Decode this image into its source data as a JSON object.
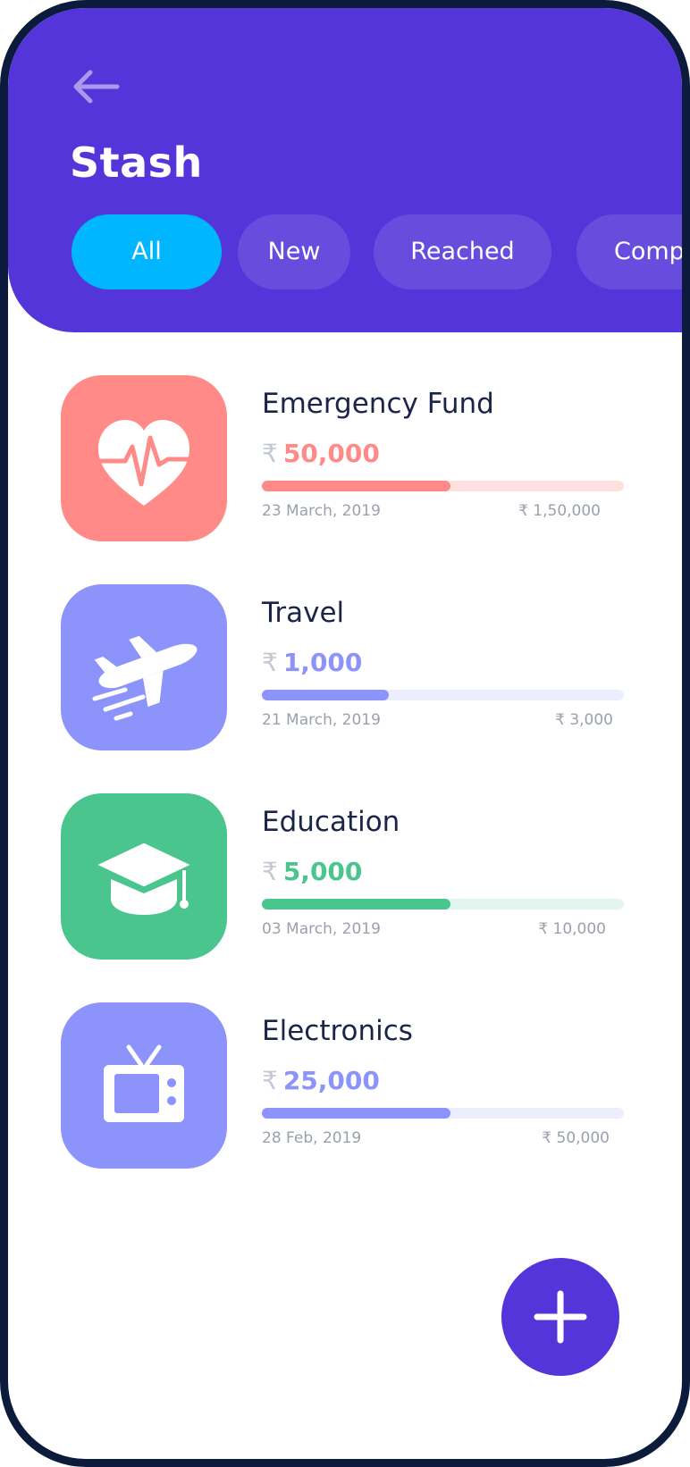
{
  "header": {
    "title": "Stash",
    "back_icon": "arrow-left-icon"
  },
  "tabs": [
    {
      "label": "All",
      "active": true
    },
    {
      "label": "New",
      "active": false
    },
    {
      "label": "Reached",
      "active": false
    },
    {
      "label": "Completed",
      "active": false
    }
  ],
  "currency_symbol": "₹",
  "goals": [
    {
      "name": "Emergency Fund",
      "amount": "50,000",
      "date": "23 March, 2019",
      "target": "₹ 1,50,000",
      "progress": 0.52,
      "icon": "heart-pulse-icon",
      "color": "#ff8a87",
      "track_color": "#ffe0df"
    },
    {
      "name": "Travel",
      "amount": "1,000",
      "date": "21 March, 2019",
      "target": "₹ 3,000",
      "progress": 0.35,
      "icon": "airplane-icon",
      "color": "#8c93fb",
      "track_color": "#eceefe"
    },
    {
      "name": "Education",
      "amount": "5,000",
      "date": "03 March, 2019",
      "target": "₹ 10,000",
      "progress": 0.52,
      "icon": "graduation-cap-icon",
      "color": "#49c58d",
      "track_color": "#e2f6ed"
    },
    {
      "name": "Electronics",
      "amount": "25,000",
      "date": "28 Feb, 2019",
      "target": "₹ 50,000",
      "progress": 0.52,
      "icon": "tv-icon",
      "color": "#8c93fb",
      "track_color": "#eceefe"
    }
  ],
  "fab": {
    "icon": "plus-icon"
  },
  "colors": {
    "primary": "#5335d9",
    "tab_active": "#00b6ff",
    "text_dark": "#1a2548",
    "text_muted": "#9aa0ad"
  }
}
